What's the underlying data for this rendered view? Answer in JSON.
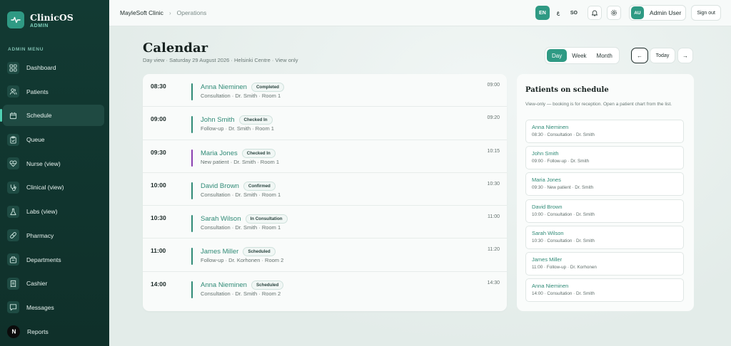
{
  "app": {
    "title": "ClinicOS",
    "role": "ADMIN"
  },
  "sidebar": {
    "menu_label": "ADMIN MENU",
    "items": [
      {
        "label": "Dashboard",
        "icon": "dashboard-icon"
      },
      {
        "label": "Patients",
        "icon": "users-icon"
      },
      {
        "label": "Schedule",
        "icon": "calendar-icon",
        "active": true
      },
      {
        "label": "Queue",
        "icon": "clipboard-icon"
      },
      {
        "label": "Nurse (view)",
        "icon": "heart-icon"
      },
      {
        "label": "Clinical (view)",
        "icon": "stethoscope-icon"
      },
      {
        "label": "Labs (view)",
        "icon": "flask-icon"
      },
      {
        "label": "Pharmacy",
        "icon": "pill-icon"
      },
      {
        "label": "Departments",
        "icon": "building-icon"
      },
      {
        "label": "Cashier",
        "icon": "receipt-icon"
      },
      {
        "label": "Messages",
        "icon": "message-icon"
      },
      {
        "label": "Reports",
        "icon": "n-logo-icon"
      }
    ]
  },
  "topbar": {
    "breadcrumb": [
      "MayleSoft Clinic",
      "Operations"
    ],
    "languages": [
      "EN",
      "ع",
      "SO"
    ],
    "selected_language": "EN",
    "user_initials": "AU",
    "user_name": "Admin User",
    "signout_label": "Sign out"
  },
  "page": {
    "title": "Calendar",
    "subtitle": "Day view · Saturday 29 August 2026 · Helsinki Centre · View only",
    "view_tabs": [
      "Day",
      "Week",
      "Month"
    ],
    "selected_view": "Day",
    "prev_label": "←",
    "today_label": "Today",
    "next_label": "→"
  },
  "schedule": [
    {
      "time": "08:30",
      "end": "09:00",
      "name": "Anna Nieminen",
      "status": "Completed",
      "detail": "Consultation · Dr. Smith · Room 1",
      "color": "#2f8a76"
    },
    {
      "time": "09:00",
      "end": "09:20",
      "name": "John Smith",
      "status": "Checked In",
      "detail": "Follow-up · Dr. Smith · Room 1",
      "color": "#2f8a76"
    },
    {
      "time": "09:30",
      "end": "10:15",
      "name": "Maria Jones",
      "status": "Checked In",
      "detail": "New patient · Dr. Smith · Room 1",
      "color": "#8a3fb0"
    },
    {
      "time": "10:00",
      "end": "10:30",
      "name": "David Brown",
      "status": "Confirmed",
      "detail": "Consultation · Dr. Smith · Room 1",
      "color": "#2f8a76"
    },
    {
      "time": "10:30",
      "end": "11:00",
      "name": "Sarah Wilson",
      "status": "In Consultation",
      "detail": "Consultation · Dr. Smith · Room 1",
      "color": "#2f8a76"
    },
    {
      "time": "11:00",
      "end": "11:20",
      "name": "James Miller",
      "status": "Scheduled",
      "detail": "Follow-up · Dr. Korhonen · Room 2",
      "color": "#2f8a76"
    },
    {
      "time": "14:00",
      "end": "14:30",
      "name": "Anna Nieminen",
      "status": "Scheduled",
      "detail": "Consultation · Dr. Smith · Room 2",
      "color": "#2f8a76"
    }
  ],
  "patients_panel": {
    "title": "Patients on schedule",
    "subtitle": "View-only — booking is for reception. Open a patient chart from the list.",
    "items": [
      {
        "name": "Anna Nieminen",
        "detail": "08:30 · Consultation · Dr. Smith"
      },
      {
        "name": "John Smith",
        "detail": "09:00 · Follow-up · Dr. Smith"
      },
      {
        "name": "Maria Jones",
        "detail": "09:30 · New patient · Dr. Smith"
      },
      {
        "name": "David Brown",
        "detail": "10:00 · Consultation · Dr. Smith"
      },
      {
        "name": "Sarah Wilson",
        "detail": "10:30 · Consultation · Dr. Smith"
      },
      {
        "name": "James Miller",
        "detail": "11:00 · Follow-up · Dr. Korhonen"
      },
      {
        "name": "Anna Nieminen",
        "detail": "14:00 · Consultation · Dr. Smith"
      }
    ]
  },
  "colors": {
    "accent": "#2f9a84",
    "sidebar": "#123a33",
    "accent_text": "#2f8a76",
    "purple": "#8a3fb0"
  }
}
